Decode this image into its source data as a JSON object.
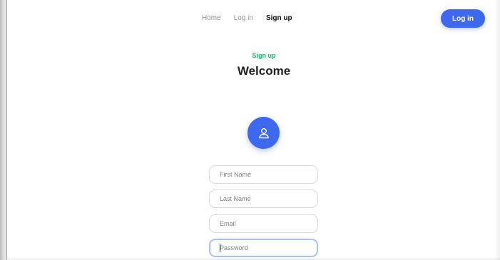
{
  "nav": {
    "links": [
      "Home",
      "Log in",
      "Sign up"
    ],
    "active": "Sign up",
    "login_button": "Log in"
  },
  "header": {
    "eyebrow": "Sign up",
    "title": "Welcome"
  },
  "avatar": {
    "icon": "user-icon"
  },
  "form": {
    "first_name": {
      "placeholder": "First Name",
      "value": ""
    },
    "last_name": {
      "placeholder": "Last Name",
      "value": ""
    },
    "email": {
      "placeholder": "Email",
      "value": ""
    },
    "password": {
      "placeholder": "Password",
      "value": "",
      "focused": true
    }
  },
  "colors": {
    "primary": "#3e68f0",
    "accent_green": "#22b06a",
    "focus_border": "#a9c0f5"
  }
}
